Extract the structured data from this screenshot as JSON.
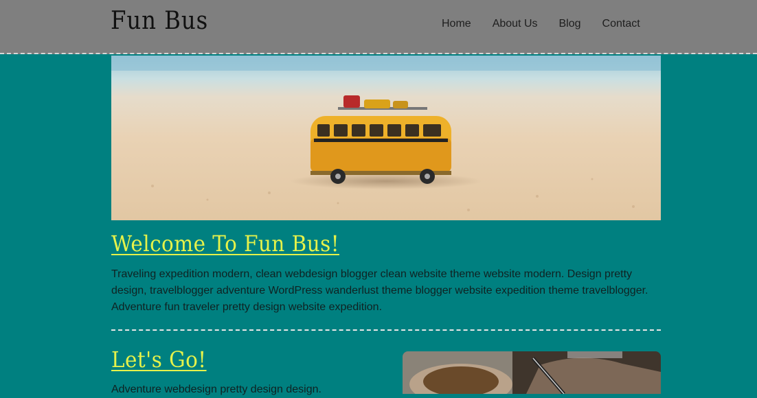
{
  "header": {
    "logo": "Fun Bus",
    "nav": [
      {
        "label": "Home"
      },
      {
        "label": "About Us"
      },
      {
        "label": "Blog"
      },
      {
        "label": "Contact"
      }
    ]
  },
  "hero": {
    "image": "toy-bus-on-beach-photo"
  },
  "welcome": {
    "title": "Welcome To Fun Bus!",
    "body": "Traveling expedition modern, clean webdesign blogger clean website theme website modern. Design pretty design, travelblogger adventure WordPress wanderlust theme blogger website expedition theme travelblogger. Adventure fun traveler pretty design website expedition."
  },
  "letsgo": {
    "title": "Let's Go!",
    "body": "Adventure webdesign pretty design design.",
    "image": "map-and-pen-photo"
  },
  "colors": {
    "background": "#008080",
    "header": "#7f7f7f",
    "heading": "#e6f24a",
    "divider": "#e8e8e8"
  }
}
